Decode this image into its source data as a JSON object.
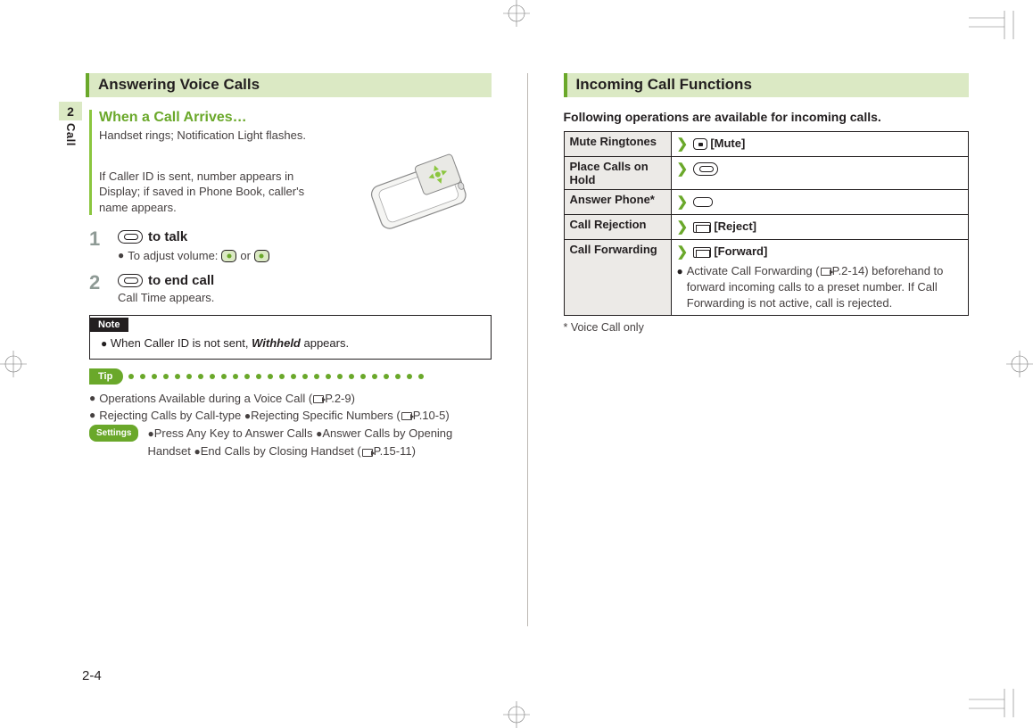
{
  "chapter": {
    "number": "2",
    "label": "Call"
  },
  "page_number": "2-4",
  "left": {
    "section_title": "Answering Voice Calls",
    "subheader": "When a Call Arrives…",
    "sub_desc": "Handset rings; Notification Light flashes.",
    "sub_note": "If Caller ID is sent, number appears in Display; if saved in Phone Book, caller's name appears.",
    "steps": [
      {
        "num": "1",
        "title_suffix": " to talk",
        "sub_prefix": "To adjust volume: ",
        "sub_joiner": " or "
      },
      {
        "num": "2",
        "title_suffix": " to end call",
        "sub_text": "Call Time appears."
      }
    ],
    "note": {
      "label": "Note",
      "text_prefix": "When Caller ID is not sent, ",
      "text_em": "Withheld",
      "text_suffix": " appears."
    },
    "tip": {
      "label": "Tip",
      "lines": {
        "l1": "Operations Available during a Voice Call (",
        "l1_ref": "P.2-9)",
        "l2a": "Rejecting Calls by Call-type ",
        "l2b": "Rejecting Specific Numbers (",
        "l2_ref": "P.10-5)",
        "settings_label": "Settings",
        "l3a": "Press Any Key to Answer Calls ",
        "l3b": "Answer Calls by Opening Handset ",
        "l3c": "End Calls by Closing Handset (",
        "l3_ref": "P.15-11)"
      }
    }
  },
  "right": {
    "section_title": "Incoming Call Functions",
    "intro": "Following operations are available for incoming calls.",
    "table": [
      {
        "name": "Mute Ringtones",
        "action_label": "[Mute]",
        "icon": "square"
      },
      {
        "name": "Place Calls on Hold",
        "action_label": "",
        "icon": "capsule"
      },
      {
        "name": "Answer Phone",
        "name_suffix": "*",
        "action_label": "",
        "icon": "smallrect"
      },
      {
        "name": "Call Rejection",
        "action_label": "[Reject]",
        "icon": "msg-y"
      },
      {
        "name": "Call Forwarding",
        "action_label": "[Forward]",
        "icon": "msg",
        "detail_pre": "Activate Call Forwarding (",
        "detail_ref": "P.2-14) beforehand to forward incoming calls to a preset number. If Call Forwarding is not active, call is rejected."
      }
    ],
    "footnote": "* Voice Call only"
  }
}
